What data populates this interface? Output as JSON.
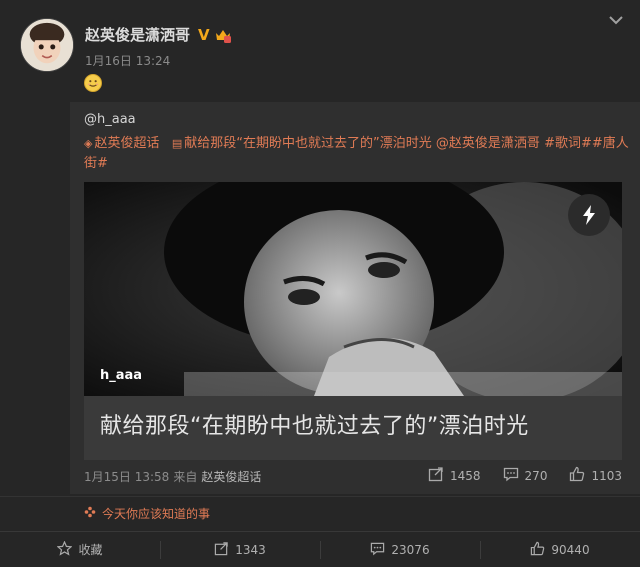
{
  "post": {
    "author": "赵英俊是潇洒哥",
    "verified_badge": "V",
    "vip_icon": "vip-crown-icon",
    "time": "1月16日 13:24",
    "emoji": "smile-emoji"
  },
  "repost": {
    "original_author": "@h_aaa",
    "text_segments": {
      "supertopic_icon": "supertopic-icon",
      "supertopic": "赵英俊超话",
      "article_icon": "article-icon",
      "body": "献给那段“在期盼中也就过去了的”漂泊时光",
      "mention": "@赵英俊是潇洒哥",
      "hashtag1": "#歌词#",
      "hashtag2": "#唐人街#"
    },
    "card": {
      "username": "h_aaa",
      "title": "献给那段“在期盼中也就过去了的”漂泊时光",
      "action_icon": "flash-icon"
    },
    "meta": {
      "time": "1月15日 13:58",
      "from_label": "来自",
      "source": "赵英俊超话"
    },
    "actions": {
      "reposts": "1458",
      "comments": "270",
      "likes": "1103"
    }
  },
  "hint": {
    "text": "今天你应该知道的事"
  },
  "footer": {
    "favorite_label": "收藏",
    "reposts": "1343",
    "comments": "23076",
    "likes": "90440"
  },
  "colors": {
    "background": "#262626",
    "repost_background": "#2f2f2f",
    "link": "#e07b55",
    "vip_gold": "#f3a81b"
  }
}
